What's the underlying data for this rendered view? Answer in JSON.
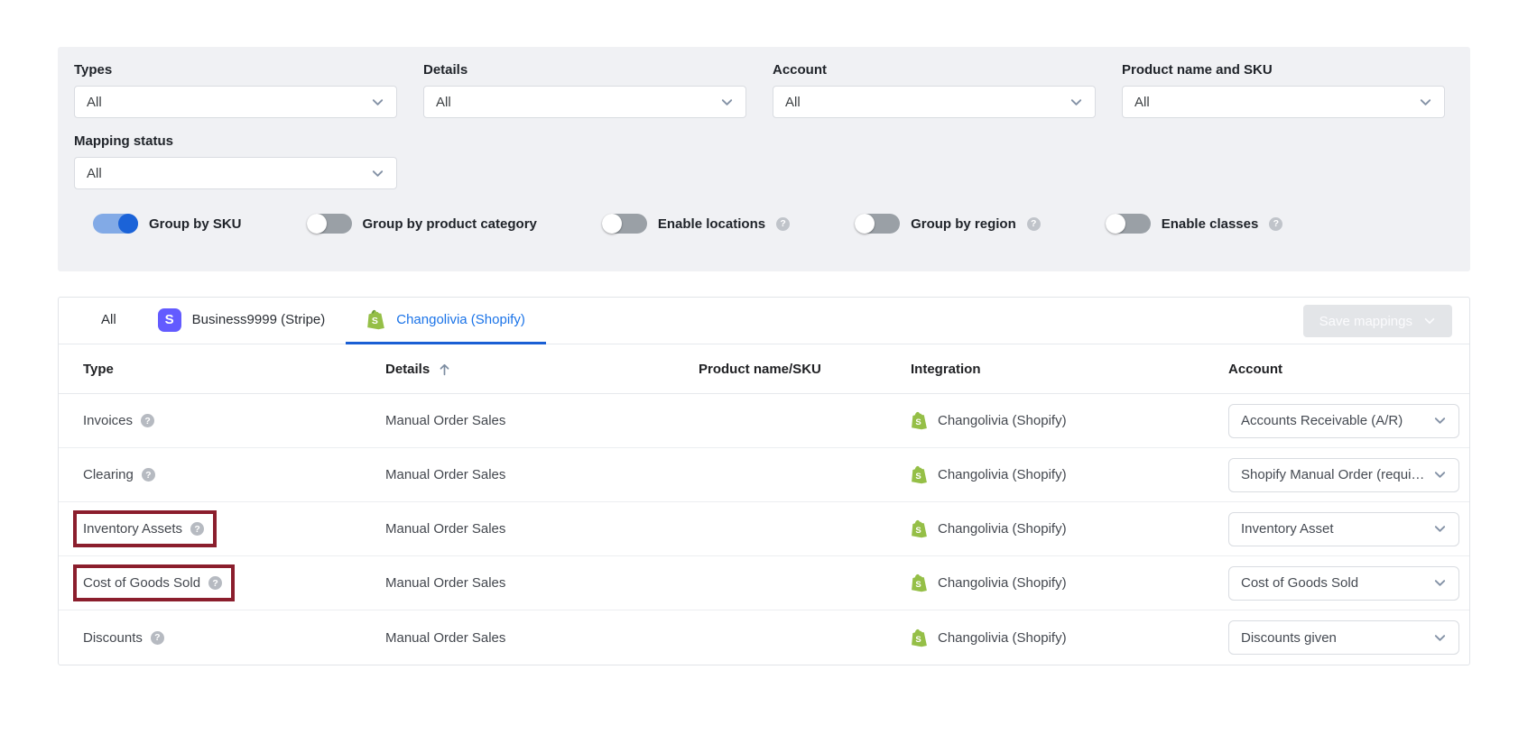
{
  "filters": {
    "fields": [
      {
        "label": "Types",
        "value": "All"
      },
      {
        "label": "Details",
        "value": "All"
      },
      {
        "label": "Account",
        "value": "All"
      },
      {
        "label": "Product name and SKU",
        "value": "All"
      },
      {
        "label": "Mapping status",
        "value": "All"
      }
    ],
    "toggles": [
      {
        "label": "Group by SKU",
        "state": "on",
        "help": false
      },
      {
        "label": "Group by product category",
        "state": "off",
        "help": false
      },
      {
        "label": "Enable locations",
        "state": "off",
        "help": true
      },
      {
        "label": "Group by region",
        "state": "off",
        "help": true
      },
      {
        "label": "Enable classes",
        "state": "off",
        "help": true
      }
    ]
  },
  "tabs": [
    {
      "label": "All",
      "icon": "none",
      "active": false
    },
    {
      "label": "Business9999 (Stripe)",
      "icon": "stripe-icon",
      "active": false
    },
    {
      "label": "Changolivia (Shopify)",
      "icon": "shopify-icon",
      "active": true
    }
  ],
  "toolbar": {
    "save_label": "Save mappings"
  },
  "table": {
    "headers": {
      "type": "Type",
      "details": "Details",
      "product": "Product name/SKU",
      "integration": "Integration",
      "account": "Account"
    },
    "sort": {
      "column": "Details",
      "direction": "ascending"
    },
    "rows": [
      {
        "type": "Invoices",
        "details": "Manual Order Sales",
        "product": "",
        "integration": "Changolivia (Shopify)",
        "account": "Accounts Receivable (A/R)",
        "highlighted": false
      },
      {
        "type": "Clearing",
        "details": "Manual Order Sales",
        "product": "",
        "integration": "Changolivia (Shopify)",
        "account": "Shopify Manual Order (requi…",
        "highlighted": false
      },
      {
        "type": "Inventory Assets",
        "details": "Manual Order Sales",
        "product": "",
        "integration": "Changolivia (Shopify)",
        "account": "Inventory Asset",
        "highlighted": true
      },
      {
        "type": "Cost of Goods Sold",
        "details": "Manual Order Sales",
        "product": "",
        "integration": "Changolivia (Shopify)",
        "account": "Cost of Goods Sold",
        "highlighted": true
      },
      {
        "type": "Discounts",
        "details": "Manual Order Sales",
        "product": "",
        "integration": "Changolivia (Shopify)",
        "account": "Discounts given",
        "highlighted": false
      }
    ]
  },
  "colors": {
    "accent_blue": "#1a73e8",
    "toggle_on_blue": "#1b63d8",
    "highlight_red": "#8b1e2d",
    "shopify_green": "#95bf47",
    "stripe_purple": "#635bff",
    "panel_gray": "#f0f1f4"
  }
}
